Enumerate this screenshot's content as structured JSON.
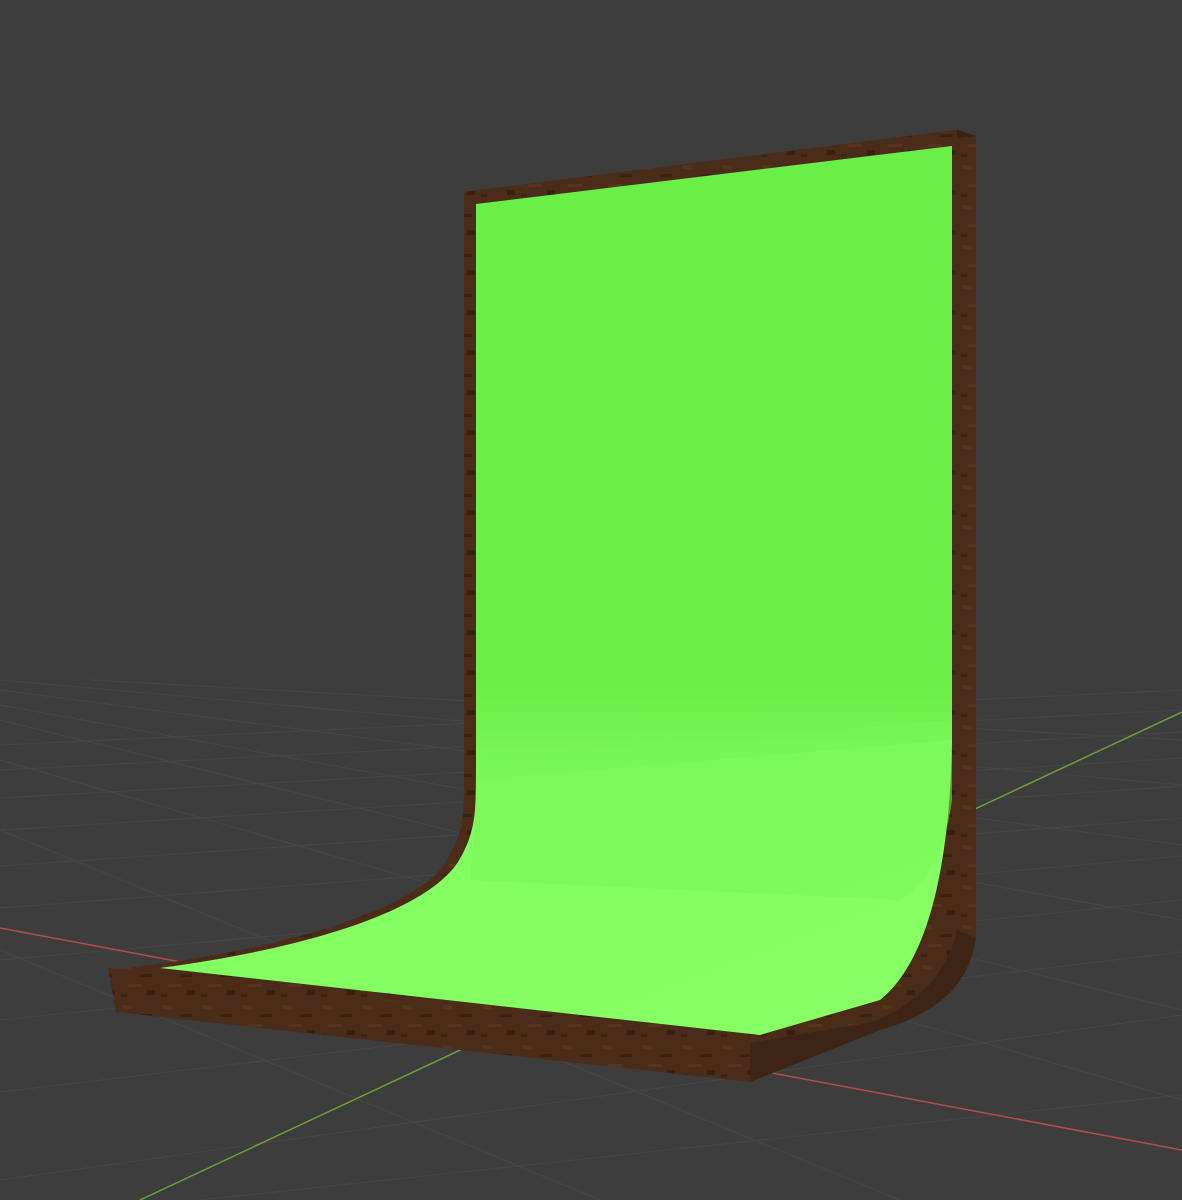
{
  "viewport": {
    "background_color": "#3d3d3d",
    "grid_color": "#4a4a4a",
    "x_axis_color": "#b94b4b",
    "y_axis_color": "#6f9f3a"
  },
  "scene": {
    "object": "green-screen-cyclorama",
    "screen_color": "#6cf24a",
    "screen_floor_color": "#86ff62",
    "frame_color": "#4a2c18"
  }
}
